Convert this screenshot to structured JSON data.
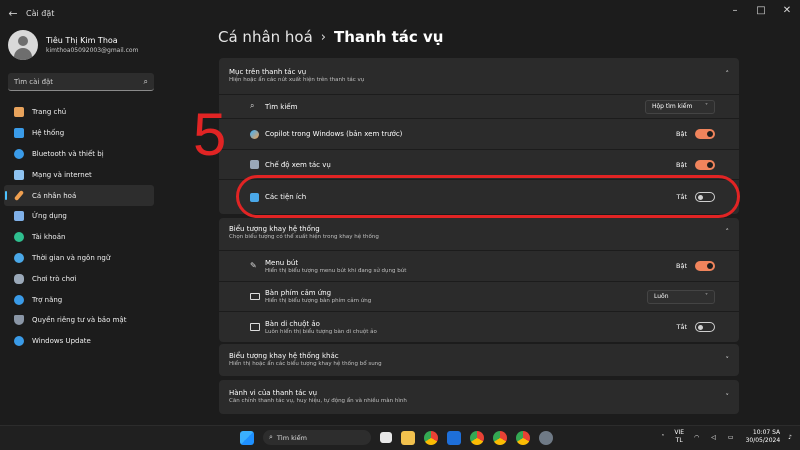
{
  "window": {
    "title": "Cài đặt",
    "controls": [
      "–",
      "□",
      "✕"
    ]
  },
  "profile": {
    "name": "Tiêu Thị Kim Thoa",
    "email": "kimthoa05092003@gmail.com"
  },
  "search": {
    "placeholder": "Tìm cài đặt"
  },
  "nav": {
    "items": [
      {
        "label": "Trang chủ",
        "icon": "home-icon",
        "color": "#e8a35c"
      },
      {
        "label": "Hệ thống",
        "icon": "monitor-icon",
        "color": "#3a9be8"
      },
      {
        "label": "Bluetooth và thiết bị",
        "icon": "bluetooth-icon",
        "color": "#3a9be8"
      },
      {
        "label": "Mạng và internet",
        "icon": "wifi-icon",
        "color": "#8fc3f0"
      },
      {
        "label": "Cá nhân hoá",
        "icon": "brush-icon",
        "color": "#f0a050",
        "active": true
      },
      {
        "label": "Ứng dụng",
        "icon": "apps-icon",
        "color": "#7fb0e8"
      },
      {
        "label": "Tài khoản",
        "icon": "account-icon",
        "color": "#2fbf8f"
      },
      {
        "label": "Thời gian và ngôn ngữ",
        "icon": "globe-clock-icon",
        "color": "#4aa8e8"
      },
      {
        "label": "Chơi trò chơi",
        "icon": "gamepad-icon",
        "color": "#9aa8b8"
      },
      {
        "label": "Trợ năng",
        "icon": "accessibility-icon",
        "color": "#3a9be8"
      },
      {
        "label": "Quyền riêng tư và bảo mật",
        "icon": "shield-icon",
        "color": "#8a96a6"
      },
      {
        "label": "Windows Update",
        "icon": "update-icon",
        "color": "#3a9be8"
      }
    ]
  },
  "breadcrumb": {
    "parent": "Cá nhân hoá",
    "separator": "›",
    "current": "Thanh tác vụ"
  },
  "section1": {
    "title": "Mục trên thanh tác vụ",
    "subtitle": "Hiện hoặc ẩn các nút xuất hiện trên thanh tác vụ",
    "chevron": "˄",
    "rows": {
      "search": {
        "label": "Tìm kiếm",
        "dropdown": "Hộp tìm kiếm",
        "icon": "search-icon"
      },
      "copilot": {
        "label": "Copilot trong Windows (bản xem trước)",
        "state": "Bật",
        "icon": "copilot-icon"
      },
      "taskview": {
        "label": "Chế độ xem tác vụ",
        "state": "Bật",
        "icon": "task-view-icon"
      },
      "widgets": {
        "label": "Các tiện ích",
        "state": "Tắt",
        "icon": "widgets-icon"
      }
    }
  },
  "section2": {
    "title": "Biểu tượng khay hệ thống",
    "subtitle": "Chọn biểu tượng có thể xuất hiện trong khay hệ thống",
    "chevron": "˄",
    "rows": {
      "pen": {
        "label": "Menu bút",
        "desc": "Hiển thị biểu tượng menu bút khi đang sử dụng bút",
        "state": "Bật",
        "icon": "pen-icon"
      },
      "keyboard": {
        "label": "Bàn phím cảm ứng",
        "desc": "Hiển thị biểu tượng bàn phím cảm ứng",
        "dropdown": "Luôn",
        "icon": "keyboard-icon"
      },
      "touchpad": {
        "label": "Bàn di chuột ảo",
        "desc": "Luôn hiển thị biểu tượng bàn di chuột ảo",
        "state": "Tắt",
        "icon": "touchpad-icon"
      }
    }
  },
  "section3": {
    "title": "Biểu tượng khay hệ thống khác",
    "subtitle": "Hiển thị hoặc ẩn các biểu tượng khay hệ thống bổ sung",
    "chevron": "˅"
  },
  "section4": {
    "title": "Hành vi của thanh tác vụ",
    "subtitle": "Căn chỉnh thanh tác vụ, huy hiệu, tự động ẩn và nhiều màn hình",
    "chevron": "˅"
  },
  "annotation": {
    "number": "5"
  },
  "taskbar": {
    "search_label": "Tìm kiếm",
    "lang_top": "VIE",
    "lang_bottom": "TL",
    "time": "10:07 SA",
    "date": "30/05/2024"
  },
  "colors": {
    "accent_toggle": "#f0845c",
    "highlight": "#e12424",
    "active_indicator": "#4cc2ff"
  }
}
